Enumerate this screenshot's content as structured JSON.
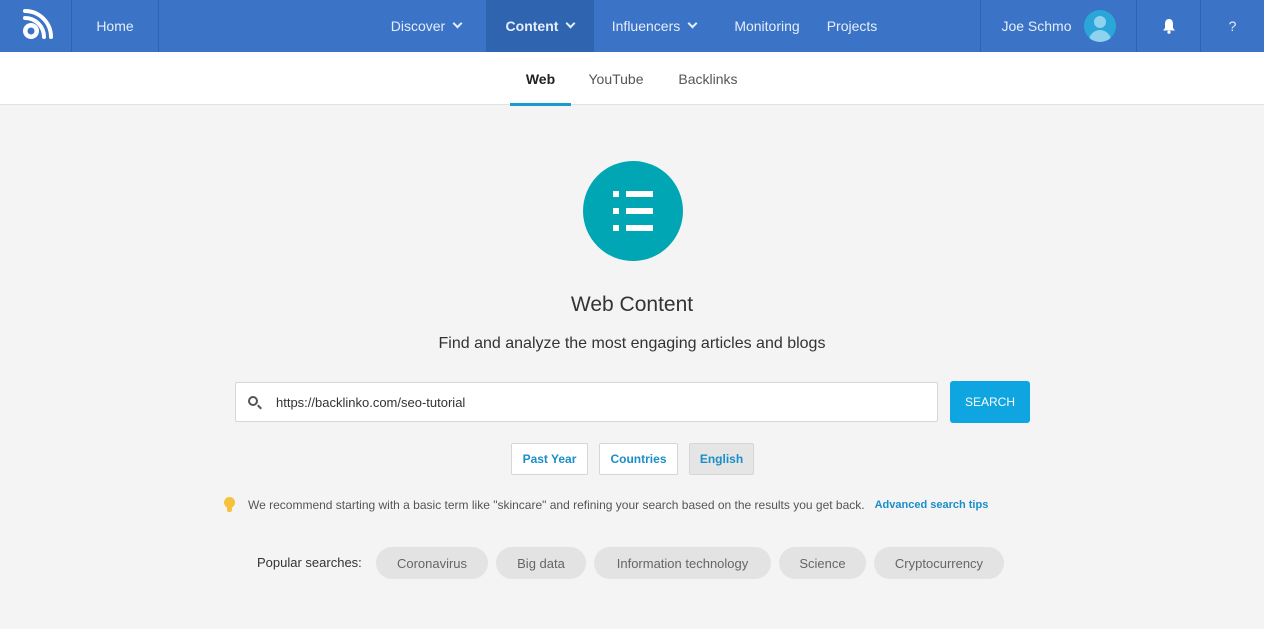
{
  "nav": {
    "logo_icon": "rss-logo-icon",
    "home": "Home",
    "discover": "Discover",
    "content": "Content",
    "influencers": "Influencers",
    "monitoring": "Monitoring",
    "projects": "Projects",
    "user_name": "Joe Schmo",
    "bell_icon": "bell-icon",
    "help": "?",
    "bar_color": "#3b73c6"
  },
  "subtabs": [
    {
      "label": "Web",
      "active": true
    },
    {
      "label": "YouTube",
      "active": false
    },
    {
      "label": "Backlinks",
      "active": false
    }
  ],
  "hero": {
    "icon": "list-icon",
    "title": "Web Content",
    "subtitle": "Find and analyze the most engaging articles and blogs"
  },
  "search": {
    "value": "https://backlinko.com/seo-tutorial",
    "button_label": "SEARCH"
  },
  "filters": [
    "Past Year",
    "Countries",
    "English"
  ],
  "tip": {
    "text": "We recommend starting with a basic term like \"skincare\" and refining your search based on the results you get back.",
    "link": "Advanced search tips"
  },
  "popular": {
    "label": "Popular searches:",
    "items": [
      "Coronavirus",
      "Big data",
      "Information technology",
      "Science",
      "Cryptocurrency"
    ]
  }
}
